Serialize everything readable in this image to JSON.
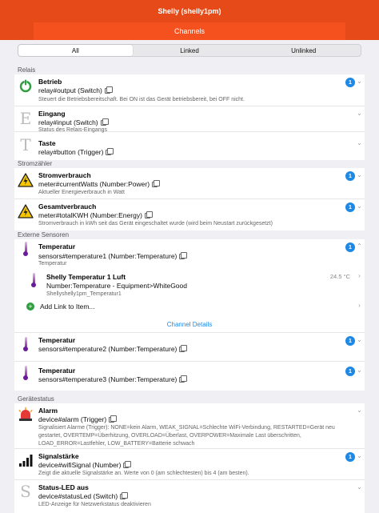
{
  "header": {
    "title": "Shelly (shelly1pm)",
    "subtitle": "Channels"
  },
  "tabs": [
    {
      "label": "All"
    },
    {
      "label": "Linked"
    },
    {
      "label": "Unlinked"
    }
  ],
  "sections": {
    "relais": "Relais",
    "strom": "Stromzähler",
    "sensoren": "Externe Sensoren",
    "status": "Gerätestatus"
  },
  "channels": {
    "betrieb": {
      "title": "Betrieb",
      "channel": "relay#output (Switch)",
      "desc": "Steuert die Betriebsbereitschaft. Bei ON ist das Gerät betriebsbereit, bei OFF nicht.",
      "count": "1"
    },
    "eingang": {
      "title": "Eingang",
      "channel": "relay#input (Switch)",
      "desc": "Status des Relais-Eingangs",
      "letter": "E"
    },
    "taste": {
      "title": "Taste",
      "channel": "relay#button (Trigger)",
      "letter": "T"
    },
    "strom": {
      "title": "Stromverbrauch",
      "channel": "meter#currentWatts (Number:Power)",
      "desc": "Aktueller Energieverbrauch in Watt",
      "count": "1"
    },
    "gesamt": {
      "title": "Gesamtverbrauch",
      "channel": "meter#totalKWH (Number:Energy)",
      "desc": "Stromverbrauch in kWh seit das Gerät eingeschaltet wurde (wird beim Neustart zurückgesetzt)",
      "count": "1"
    },
    "temp1": {
      "title": "Temperatur",
      "channel": "sensors#temperature1 (Number:Temperature)",
      "desc": "Temperatur",
      "count": "1"
    },
    "temp2": {
      "title": "Temperatur",
      "channel": "sensors#temperature2 (Number:Temperature)",
      "count": "1"
    },
    "temp3": {
      "title": "Temperatur",
      "channel": "sensors#temperature3 (Number:Temperature)",
      "count": "1"
    },
    "alarm": {
      "title": "Alarm",
      "channel": "device#alarm (Trigger)",
      "desc": "Signalisiert Alarme (Trigger): NONE=kein Alarm, WEAK_SIGNAL=Schlechte WiFi-Verbindung, RESTARTED=Gerät neu gestartet, OVERTEMP=Überhitzung, OVERLOAD=Überlast, OVERPOWER=Maximale Last überschritten, LOAD_ERROR=Lastfehler, LOW_BATTERY=Batterie schwach"
    },
    "signal": {
      "title": "Signalstärke",
      "channel": "device#wifiSignal (Number)",
      "desc": "Zeigt die aktuelle Signalstärke an. Werte von 0 (am schlechtesten) bis 4 (am besten).",
      "count": "1"
    },
    "led": {
      "title": "Status-LED aus",
      "channel": "device#statusLed (Switch)",
      "desc": "LED-Anzeige für Netzwerkstatus deaktivieren"
    }
  },
  "linked_item": {
    "title": "Shelly Temperatur 1 Luft",
    "type": "Number:Temperature - Equipment>WhiteGood",
    "name": "Shellyshelly1pm_Temperatur1",
    "value": "24.5 °C"
  },
  "add_link": "Add Link to Item...",
  "channel_details": "Channel Details"
}
